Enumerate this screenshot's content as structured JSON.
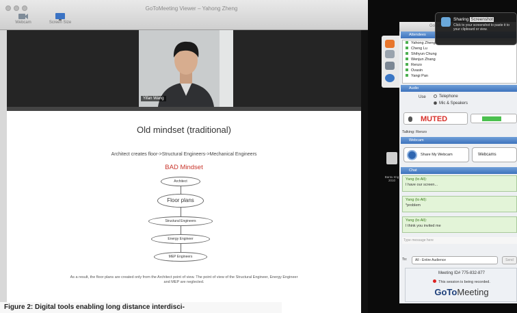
{
  "window": {
    "title": "GoToMeeting Viewer – Yahong Zheng",
    "toolbar": [
      {
        "label": "Webcam",
        "icon": "webcam-icon"
      },
      {
        "label": "Screen Size",
        "icon": "monitor-icon"
      }
    ]
  },
  "webcam": {
    "name": "Yifan Wang"
  },
  "slide": {
    "title": "Old mindset (traditional)",
    "subtitle": "Architect creates floor->Structural Engineers->Mechanical Engineers",
    "red_heading": "BAD Mindset",
    "nodes": [
      "Architect",
      "Floor plans",
      "Structural Engineers",
      "Energy Engineer",
      "MEP Engineers"
    ],
    "footnote": "As a result, the floor plans are created only from the Architect point of view. The point of view of the Structural Engineer, Energy Engineer and MEP are neglected."
  },
  "caption": "Figure 2: Digital tools enabling long distance interdisci-",
  "notification": {
    "title_prefix": "Sharing",
    "title_highlight": "Screenshot",
    "body": "Click to your screenshot to paste it to your clipboard or view."
  },
  "panel": {
    "title": "GoToMeeting",
    "sections": {
      "attendees": "Attendees",
      "audio": "Audio",
      "webcam": "Webcam",
      "chat": "Chat"
    },
    "attendees": [
      "Yahong Zheng",
      "Cheng Lu",
      "Shihyun Chung",
      "Wenjun Zhang",
      "Renzo",
      "Ovasin",
      "Yangi Pan"
    ],
    "audio": {
      "use_label": "Use",
      "option1": "Telephone",
      "option2": "Mic & Speakers",
      "muted": "MUTED",
      "talking": "Talking: Renzo"
    },
    "webcam": {
      "share_button": "Share My Webcam",
      "select": "Webcams"
    },
    "chat": [
      {
        "from": "Yang (to All):",
        "text": "I have our screen..."
      },
      {
        "from": "Yang (to All):",
        "text": "*problem"
      },
      {
        "from": "Yang (to All):",
        "text": "I think you invited me"
      }
    ],
    "message_placeholder": "Type message here",
    "to_label": "To:",
    "to_value": "All - Entire Audience",
    "send": "Send",
    "meeting_id": "Meeting ID# 775-832-877",
    "recording": "This session is being recorded.",
    "brand_bold": "GoTo",
    "brand_light": "Meeting"
  },
  "desktop_icon": {
    "label": "Bantu Img 2010"
  },
  "colors": {
    "accent": "#3e73bd",
    "muted": "#d8302a",
    "chat_bg": "#e3f4d8",
    "slide_red": "#c8342a"
  }
}
